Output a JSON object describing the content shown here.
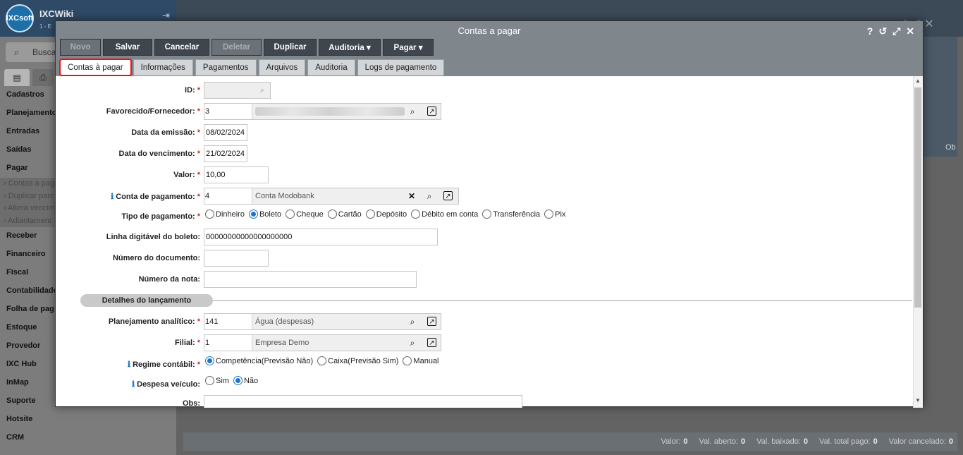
{
  "app": {
    "title": "IXCWiki",
    "subtitle": "1 - E",
    "logo_text": "IXCsoft",
    "search_placeholder": "Busca"
  },
  "sidebar": {
    "tab1_icon": "▤",
    "tab2_icon": "⎙",
    "items": [
      {
        "label": "Cadastros",
        "type": "main"
      },
      {
        "label": "Planejamento",
        "type": "main"
      },
      {
        "label": "Entradas",
        "type": "main"
      },
      {
        "label": "Saídas",
        "type": "main"
      },
      {
        "label": "Pagar",
        "type": "main"
      },
      {
        "label": "› Contas a paga",
        "type": "sub"
      },
      {
        "label": "› Duplicar parc",
        "type": "sub"
      },
      {
        "label": "› Altera vencim",
        "type": "sub"
      },
      {
        "label": "› Adiantament",
        "type": "sub"
      },
      {
        "label": "Receber",
        "type": "main"
      },
      {
        "label": "Financeiro",
        "type": "main"
      },
      {
        "label": "Fiscal",
        "type": "main"
      },
      {
        "label": "Contabilidade",
        "type": "main"
      },
      {
        "label": "Folha de pag",
        "type": "main"
      },
      {
        "label": "Estoque",
        "type": "main"
      },
      {
        "label": "Provedor",
        "type": "main"
      },
      {
        "label": "IXC Hub",
        "type": "main"
      },
      {
        "label": "InMap",
        "type": "main"
      },
      {
        "label": "Suporte",
        "type": "main"
      },
      {
        "label": "Hotsite",
        "type": "main"
      },
      {
        "label": "CRM",
        "type": "main"
      }
    ]
  },
  "background": {
    "ob_label": "Ob",
    "footer": [
      {
        "label": "Valor:",
        "value": "0"
      },
      {
        "label": "Val. aberto:",
        "value": "0"
      },
      {
        "label": "Val. baixado:",
        "value": "0"
      },
      {
        "label": "Val. total pago:",
        "value": "0"
      },
      {
        "label": "Valor cancelado:",
        "value": "0"
      }
    ]
  },
  "modal": {
    "title": "Contas a pagar",
    "icons": [
      "help-icon",
      "history-icon",
      "expand-icon",
      "close-icon"
    ],
    "toolbar": {
      "novo": "Novo",
      "salvar": "Salvar",
      "cancelar": "Cancelar",
      "deletar": "Deletar",
      "duplicar": "Duplicar",
      "auditoria": "Auditoria ▾",
      "pagar": "Pagar ▾"
    },
    "tabs": [
      "Contas à pagar",
      "Informações",
      "Pagamentos",
      "Arquivos",
      "Auditoria",
      "Logs de pagamento"
    ],
    "active_tab": 0
  },
  "form": {
    "id": {
      "label": "ID:",
      "value": ""
    },
    "favorecido": {
      "label": "Favorecido/Fornecedor:",
      "code": "3"
    },
    "data_emissao": {
      "label": "Data da emissão:",
      "value": "08/02/2024"
    },
    "data_vencimento": {
      "label": "Data do vencimento:",
      "value": "21/02/2024"
    },
    "valor": {
      "label": "Valor:",
      "value": "10,00"
    },
    "conta_pagamento": {
      "label": "Conta de pagamento:",
      "code": "4",
      "desc": "Conta Modobank"
    },
    "tipo_pagamento": {
      "label": "Tipo de pagamento:",
      "options": [
        "Dinheiro",
        "Boleto",
        "Cheque",
        "Cartão",
        "Depósito",
        "Débito em conta",
        "Transferência",
        "Pix"
      ],
      "selected": "Boleto"
    },
    "linha_digitavel": {
      "label": "Linha digitável do boleto:",
      "value": "00000000000000000000"
    },
    "numero_documento": {
      "label": "Número do documento:",
      "value": ""
    },
    "numero_nota": {
      "label": "Número da nota:",
      "value": ""
    },
    "section_title": "Detalhes do lançamento",
    "planejamento": {
      "label": "Planejamento analítico:",
      "code": "141",
      "desc": "Água (despesas)"
    },
    "filial": {
      "label": "Filial:",
      "code": "1",
      "desc": "Empresa Demo"
    },
    "regime": {
      "label": "Regime contábil:",
      "options": [
        "Competência(Previsão Não)",
        "Caixa(Previsão Sim)",
        "Manual"
      ],
      "selected": "Competência(Previsão Não)"
    },
    "despesa_veiculo": {
      "label": "Despesa veículo:",
      "options": [
        "Sim",
        "Não"
      ],
      "selected": "Não"
    },
    "obs": {
      "label": "Obs:",
      "value": ""
    }
  },
  "colors": {
    "required": "#dd2222",
    "info": "#1e76c8",
    "highlight": "#ee1111",
    "toolbar": "#3f464d"
  }
}
